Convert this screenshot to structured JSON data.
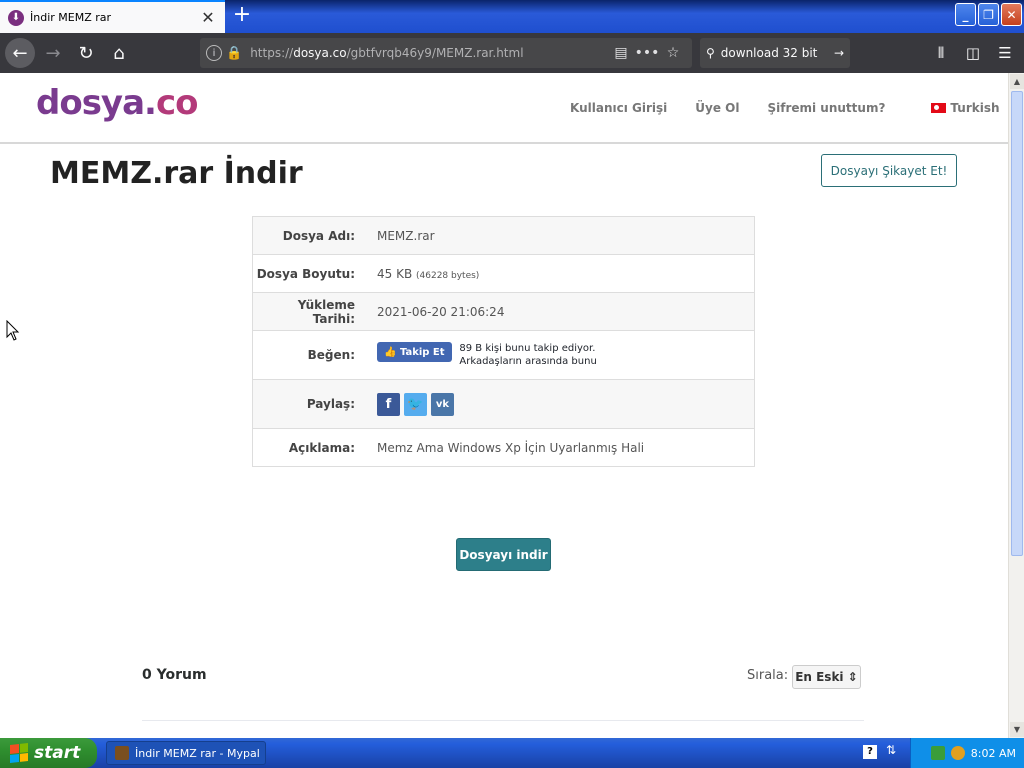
{
  "browser": {
    "tab_title": "İndir MEMZ rar",
    "tab_favicon": "dosya-favicon",
    "url_protocol": "https://",
    "url_domain": "dosya.co",
    "url_path": "/gbtfvrqb46y9/MEMZ.rar.html",
    "search_value": "download 32 bit"
  },
  "site": {
    "logo_main": "dosya.",
    "logo_co": "co",
    "nav": {
      "login": "Kullanıcı Girişi",
      "register": "Üye Ol",
      "forgot": "Şifremi unuttum?",
      "language": "Turkish"
    },
    "page_title": "MEMZ.rar İndir",
    "complaint_button": "Dosyayı Şikayet Et!"
  },
  "file_info": {
    "name_label": "Dosya Adı:",
    "name_value": "MEMZ.rar",
    "size_label": "Dosya Boyutu:",
    "size_value": "45 KB",
    "size_bytes": "(46228 bytes)",
    "date_label": "Yükleme Tarihi:",
    "date_value": "2021-06-20 21:06:24",
    "like_label": "Beğen:",
    "fb_follow_label": "Takip Et",
    "fb_line1": "89 B kişi bunu takip ediyor.",
    "fb_line2": "Arkadaşların arasında bunu",
    "share_label": "Paylaş:",
    "desc_label": "Açıklama:",
    "desc_value": "Memz Ama Windows Xp İçin Uyarlanmış Hali"
  },
  "download_button": "Dosyayı indir",
  "comments": {
    "count_label": "0 Yorum",
    "sort_label": "Sırala:",
    "sort_value": "En Eski"
  },
  "taskbar": {
    "start_label": "start",
    "task_label": "İndir MEMZ rar - Mypal",
    "clock": "8:02 AM"
  }
}
